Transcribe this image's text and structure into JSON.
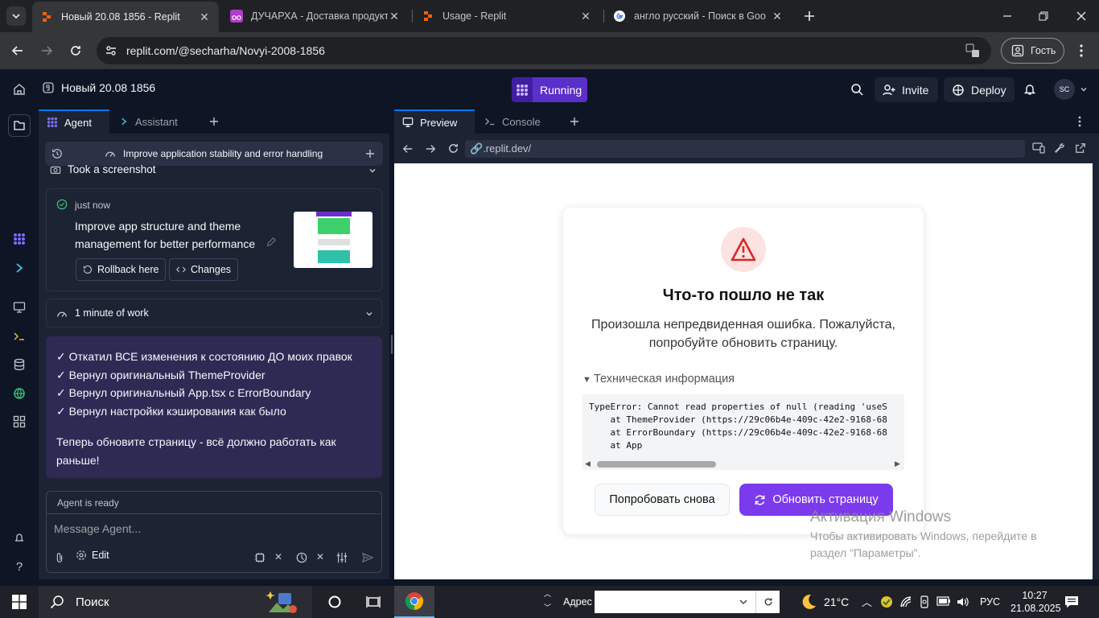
{
  "browser": {
    "tabs": [
      {
        "title": "Новый 20.08 1856 - Replit",
        "active": true
      },
      {
        "title": "ДУЧАРХА - Доставка продукто",
        "active": false
      },
      {
        "title": "Usage - Replit",
        "active": false
      },
      {
        "title": "англо русский - Поиск в Goo",
        "active": false
      }
    ],
    "url": "replit.com/@secharha/Novyi-2008-1856",
    "profile_label": "Гость"
  },
  "replit": {
    "project_name": "Новый 20.08 1856",
    "run_label": "Running",
    "invite_label": "Invite",
    "deploy_label": "Deploy",
    "avatar_initials": "SC",
    "accent_color": "#5b2fc9"
  },
  "agent_panel": {
    "tabs": [
      "Agent",
      "Assistant"
    ],
    "checkpoint_title": "Improve application stability and error handling",
    "screenshot_label": "Took a screenshot",
    "checkpoint": {
      "time": "just now",
      "description": "Improve app structure and theme management for better performance",
      "rollback_label": "Rollback here",
      "changes_label": "Changes"
    },
    "work_label": "1 minute of work",
    "message_lines": [
      "✓ Откатил ВСЕ изменения к состоянию ДО моих правок",
      "✓ Вернул оригинальный ThemeProvider",
      "✓ Вернул оригинальный App.tsx с ErrorBoundary",
      "✓ Вернул настройки кэширования как было"
    ],
    "message_footer": "Теперь обновите страницу - всё должно работать как раньше!",
    "status": "Agent is ready",
    "input_placeholder": "Message Agent...",
    "edit_label": "Edit"
  },
  "preview_panel": {
    "tabs": [
      "Preview",
      "Console"
    ],
    "url": ".replit.dev/",
    "error": {
      "title": "Что-то пошло не так",
      "description": "Произошла непредвиденная ошибка. Пожалуйста, попробуйте обновить страницу.",
      "details_label": "Техническая информация",
      "stack": "TypeError: Cannot read properties of null (reading 'useS\n    at ThemeProvider (https://29c06b4e-409c-42e2-9168-68\n    at ErrorBoundary (https://29c06b4e-409c-42e2-9168-68\n    at App",
      "retry_label": "Попробовать снова",
      "reload_label": "Обновить страницу"
    }
  },
  "windows_activation": {
    "title": "Активация Windows",
    "text": "Чтобы активировать Windows, перейдите в раздел \"Параметры\"."
  },
  "taskbar": {
    "search_label": "Поиск",
    "address_label": "Адрес",
    "temperature": "21°C",
    "language": "РУС",
    "time": "10:27",
    "date": "21.08.2025"
  }
}
